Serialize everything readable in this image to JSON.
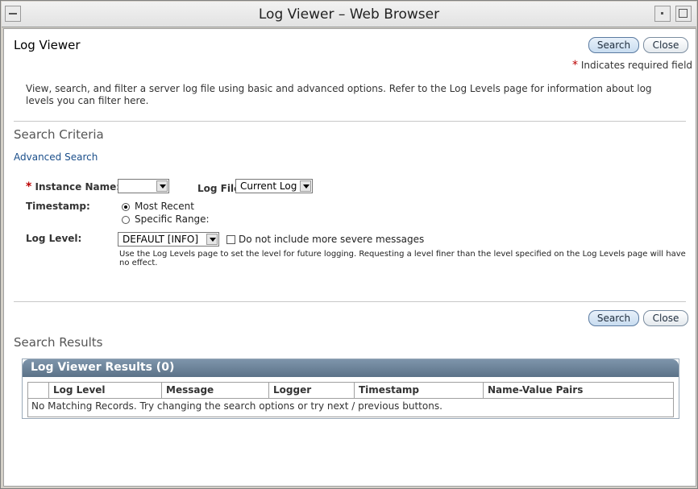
{
  "window": {
    "title": "Log Viewer – Web Browser"
  },
  "page": {
    "title": "Log Viewer",
    "search_label": "Search",
    "close_label": "Close",
    "required_note": "Indicates required field",
    "required_star": "*",
    "description": "View, search, and filter a server log file using basic and advanced options. Refer to the Log Levels page for information about log levels you can filter here."
  },
  "criteria": {
    "title": "Search Criteria",
    "advanced_link": "Advanced Search",
    "instance_label": "Instance Name:",
    "instance_value": "",
    "logfile_label": "Log File:",
    "logfile_value": "Current Log",
    "timestamp_label": "Timestamp:",
    "most_recent": "Most Recent",
    "specific_range": "Specific Range:",
    "loglevel_label": "Log Level:",
    "loglevel_value": "DEFAULT [INFO]",
    "exclude_severe": "Do not include more severe messages",
    "help": "Use the Log Levels page to set the level for future logging. Requesting a level finer than the level specified on the Log Levels page will have no effect."
  },
  "results": {
    "title": "Search Results",
    "table_title": "Log Viewer Results (0)",
    "columns": [
      "Log Level",
      "Message",
      "Logger",
      "Timestamp",
      "Name-Value Pairs"
    ],
    "empty": "No Matching Records. Try changing the search options or try next / previous buttons."
  }
}
